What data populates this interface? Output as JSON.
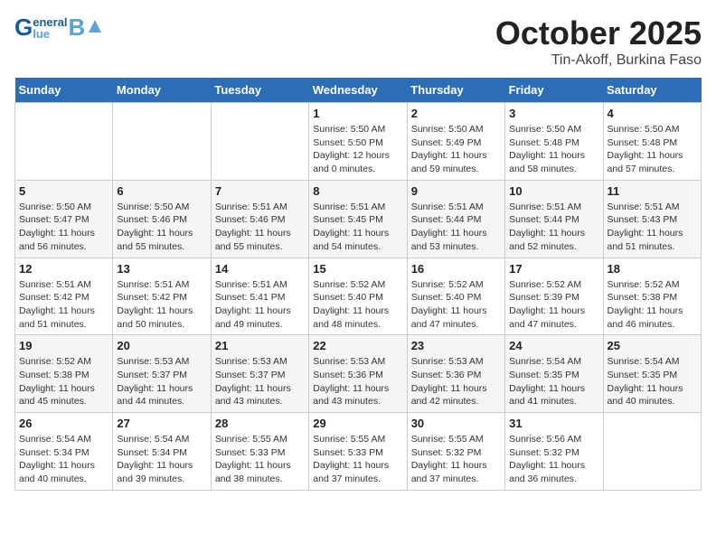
{
  "header": {
    "logo_general": "General",
    "logo_blue": "Blue",
    "month": "October 2025",
    "location": "Tin-Akoff, Burkina Faso"
  },
  "days_of_week": [
    "Sunday",
    "Monday",
    "Tuesday",
    "Wednesday",
    "Thursday",
    "Friday",
    "Saturday"
  ],
  "weeks": [
    [
      {
        "day": "",
        "info": ""
      },
      {
        "day": "",
        "info": ""
      },
      {
        "day": "",
        "info": ""
      },
      {
        "day": "1",
        "info": "Sunrise: 5:50 AM\nSunset: 5:50 PM\nDaylight: 12 hours\nand 0 minutes."
      },
      {
        "day": "2",
        "info": "Sunrise: 5:50 AM\nSunset: 5:49 PM\nDaylight: 11 hours\nand 59 minutes."
      },
      {
        "day": "3",
        "info": "Sunrise: 5:50 AM\nSunset: 5:48 PM\nDaylight: 11 hours\nand 58 minutes."
      },
      {
        "day": "4",
        "info": "Sunrise: 5:50 AM\nSunset: 5:48 PM\nDaylight: 11 hours\nand 57 minutes."
      }
    ],
    [
      {
        "day": "5",
        "info": "Sunrise: 5:50 AM\nSunset: 5:47 PM\nDaylight: 11 hours\nand 56 minutes."
      },
      {
        "day": "6",
        "info": "Sunrise: 5:50 AM\nSunset: 5:46 PM\nDaylight: 11 hours\nand 55 minutes."
      },
      {
        "day": "7",
        "info": "Sunrise: 5:51 AM\nSunset: 5:46 PM\nDaylight: 11 hours\nand 55 minutes."
      },
      {
        "day": "8",
        "info": "Sunrise: 5:51 AM\nSunset: 5:45 PM\nDaylight: 11 hours\nand 54 minutes."
      },
      {
        "day": "9",
        "info": "Sunrise: 5:51 AM\nSunset: 5:44 PM\nDaylight: 11 hours\nand 53 minutes."
      },
      {
        "day": "10",
        "info": "Sunrise: 5:51 AM\nSunset: 5:44 PM\nDaylight: 11 hours\nand 52 minutes."
      },
      {
        "day": "11",
        "info": "Sunrise: 5:51 AM\nSunset: 5:43 PM\nDaylight: 11 hours\nand 51 minutes."
      }
    ],
    [
      {
        "day": "12",
        "info": "Sunrise: 5:51 AM\nSunset: 5:42 PM\nDaylight: 11 hours\nand 51 minutes."
      },
      {
        "day": "13",
        "info": "Sunrise: 5:51 AM\nSunset: 5:42 PM\nDaylight: 11 hours\nand 50 minutes."
      },
      {
        "day": "14",
        "info": "Sunrise: 5:51 AM\nSunset: 5:41 PM\nDaylight: 11 hours\nand 49 minutes."
      },
      {
        "day": "15",
        "info": "Sunrise: 5:52 AM\nSunset: 5:40 PM\nDaylight: 11 hours\nand 48 minutes."
      },
      {
        "day": "16",
        "info": "Sunrise: 5:52 AM\nSunset: 5:40 PM\nDaylight: 11 hours\nand 47 minutes."
      },
      {
        "day": "17",
        "info": "Sunrise: 5:52 AM\nSunset: 5:39 PM\nDaylight: 11 hours\nand 47 minutes."
      },
      {
        "day": "18",
        "info": "Sunrise: 5:52 AM\nSunset: 5:38 PM\nDaylight: 11 hours\nand 46 minutes."
      }
    ],
    [
      {
        "day": "19",
        "info": "Sunrise: 5:52 AM\nSunset: 5:38 PM\nDaylight: 11 hours\nand 45 minutes."
      },
      {
        "day": "20",
        "info": "Sunrise: 5:53 AM\nSunset: 5:37 PM\nDaylight: 11 hours\nand 44 minutes."
      },
      {
        "day": "21",
        "info": "Sunrise: 5:53 AM\nSunset: 5:37 PM\nDaylight: 11 hours\nand 43 minutes."
      },
      {
        "day": "22",
        "info": "Sunrise: 5:53 AM\nSunset: 5:36 PM\nDaylight: 11 hours\nand 43 minutes."
      },
      {
        "day": "23",
        "info": "Sunrise: 5:53 AM\nSunset: 5:36 PM\nDaylight: 11 hours\nand 42 minutes."
      },
      {
        "day": "24",
        "info": "Sunrise: 5:54 AM\nSunset: 5:35 PM\nDaylight: 11 hours\nand 41 minutes."
      },
      {
        "day": "25",
        "info": "Sunrise: 5:54 AM\nSunset: 5:35 PM\nDaylight: 11 hours\nand 40 minutes."
      }
    ],
    [
      {
        "day": "26",
        "info": "Sunrise: 5:54 AM\nSunset: 5:34 PM\nDaylight: 11 hours\nand 40 minutes."
      },
      {
        "day": "27",
        "info": "Sunrise: 5:54 AM\nSunset: 5:34 PM\nDaylight: 11 hours\nand 39 minutes."
      },
      {
        "day": "28",
        "info": "Sunrise: 5:55 AM\nSunset: 5:33 PM\nDaylight: 11 hours\nand 38 minutes."
      },
      {
        "day": "29",
        "info": "Sunrise: 5:55 AM\nSunset: 5:33 PM\nDaylight: 11 hours\nand 37 minutes."
      },
      {
        "day": "30",
        "info": "Sunrise: 5:55 AM\nSunset: 5:32 PM\nDaylight: 11 hours\nand 37 minutes."
      },
      {
        "day": "31",
        "info": "Sunrise: 5:56 AM\nSunset: 5:32 PM\nDaylight: 11 hours\nand 36 minutes."
      },
      {
        "day": "",
        "info": ""
      }
    ]
  ]
}
